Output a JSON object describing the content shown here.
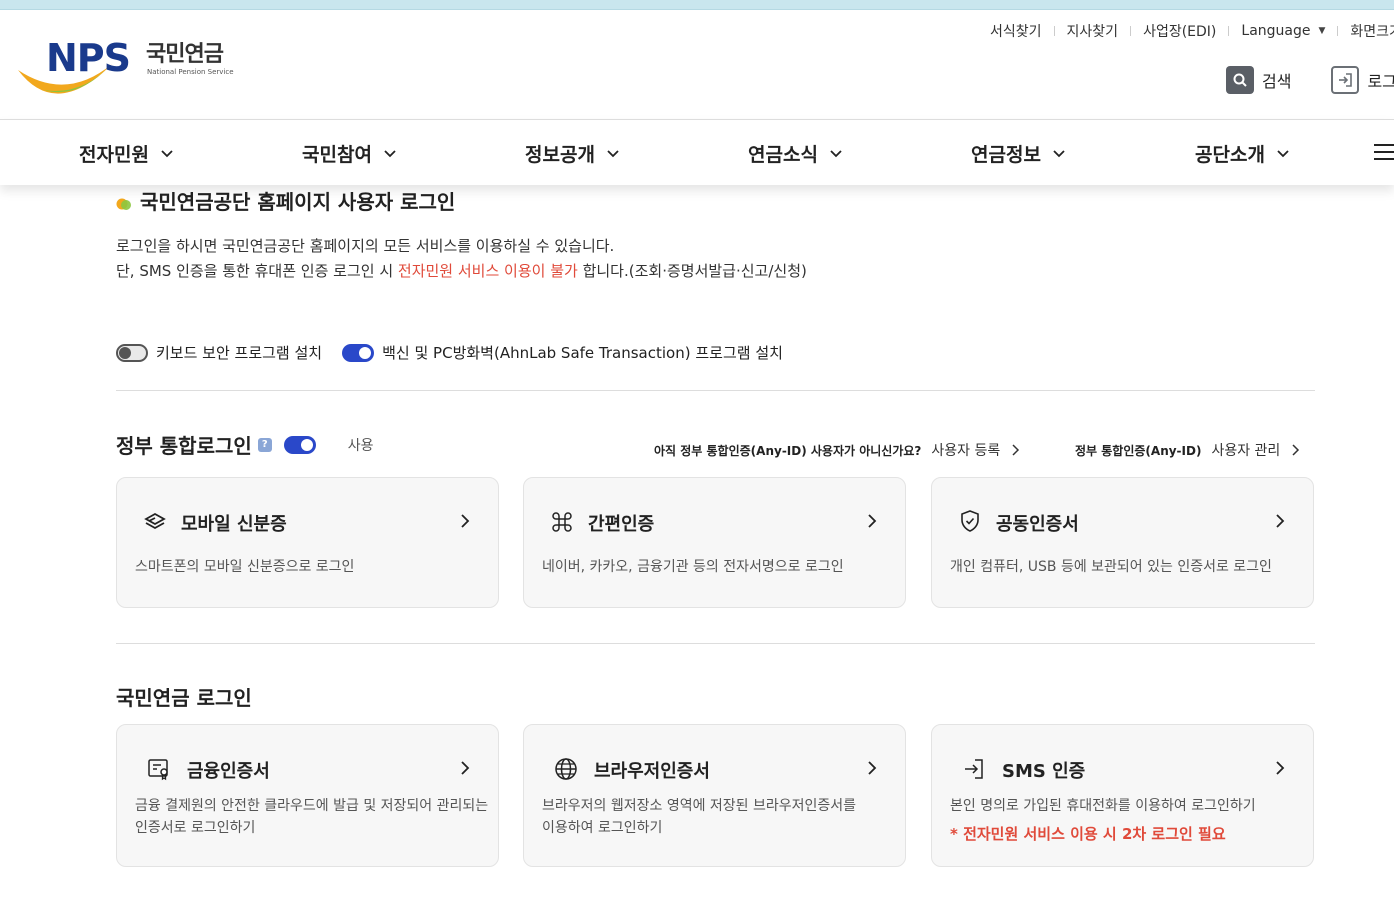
{
  "brand": {
    "logo_main": "NPS",
    "logo_kr": "국민연금",
    "logo_en": "National Pension Service"
  },
  "util_links": [
    "서식찾기",
    "지사찾기",
    "사업장(EDI)",
    "Language",
    "화면크기"
  ],
  "tools": {
    "search": "검색",
    "login": "로그인"
  },
  "gnb": [
    "전자민원",
    "국민참여",
    "정보공개",
    "연금소식",
    "연금정보",
    "공단소개"
  ],
  "page": {
    "title": "국민연금공단 홈페이지 사용자 로그인",
    "desc_line1": "로그인을 하시면 국민연금공단 홈페이지의 모든 서비스를 이용하실 수 있습니다.",
    "desc_line2_a": "단, SMS 인증을 통한 휴대폰 인증 로그인 시 ",
    "desc_line2_red": "전자민원 서비스 이용이 불가",
    "desc_line2_b": " 합니다.(조회·증명서발급·신고/신청)"
  },
  "toggles": {
    "keyboard": {
      "label": "키보드 보안 프로그램 설치",
      "on": false
    },
    "vaccine": {
      "label": "백신 및 PC방화벽(AhnLab Safe Transaction) 프로그램 설치",
      "on": true
    }
  },
  "gov": {
    "title": "정부 통합로그인",
    "help": "?",
    "use_label": "사용",
    "use_on": true,
    "anyid_q": "아직 정부 통합인증(Any-ID) 사용자가 아니신가요?",
    "anyid_register": "사용자 등록",
    "anyid_label": "정부 통합인증(Any-ID)",
    "anyid_manage": "사용자 관리",
    "cards": [
      {
        "title": "모바일 신분증",
        "desc": "스마트폰의 모바일 신분증으로 로그인",
        "icon": "layers-icon"
      },
      {
        "title": "간편인증",
        "desc": "네이버, 카카오, 금융기관 등의 전자서명으로 로그인",
        "icon": "command-icon"
      },
      {
        "title": "공동인증서",
        "desc": "개인 컴퓨터, USB 등에 보관되어 있는 인증서로 로그인",
        "icon": "shield-icon"
      }
    ]
  },
  "nps": {
    "title": "국민연금 로그인",
    "cards": [
      {
        "title": "금융인증서",
        "desc1": "금융 결제원의 안전한 클라우드에 발급 및 저장되어 관리되는",
        "desc2": "인증서로 로그인하기",
        "icon": "certificate-icon"
      },
      {
        "title": "브라우저인증서",
        "desc1": "브라우저의 웹저장소 영역에 저장된 브라우저인증서를",
        "desc2": "이용하여 로그인하기",
        "icon": "globe-icon"
      },
      {
        "title": "SMS 인증",
        "desc1": "본인 명의로 가입된 휴대전화를 이용하여 로그인하기",
        "note": "* 전자민원 서비스 이용 시 2차 로그인 필요",
        "icon": "login-icon"
      }
    ]
  }
}
